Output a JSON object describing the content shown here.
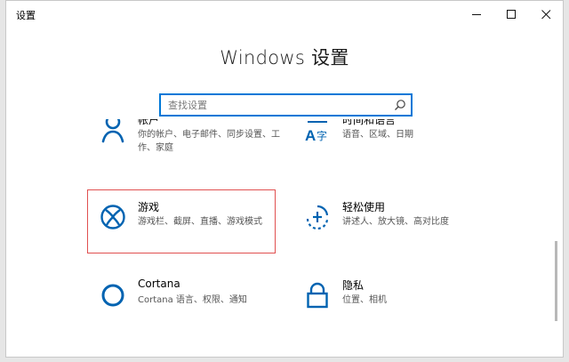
{
  "window": {
    "title": "设置"
  },
  "header": {
    "title": "Windows 设置"
  },
  "search": {
    "placeholder": "查找设置"
  },
  "tiles": [
    {
      "title": "帐户",
      "description": "你的帐户、电子邮件、同步设置、工作、家庭",
      "icon": "person-icon"
    },
    {
      "title": "时间和语言",
      "description": "语音、区域、日期",
      "icon": "time-language-icon"
    },
    {
      "title": "游戏",
      "description": "游戏栏、截屏、直播、游戏模式",
      "icon": "xbox-icon"
    },
    {
      "title": "轻松使用",
      "description": "讲述人、放大镜、高对比度",
      "icon": "ease-of-access-icon"
    },
    {
      "title": "Cortana",
      "description": "Cortana 语言、权限、通知",
      "icon": "cortana-icon"
    },
    {
      "title": "隐私",
      "description": "位置、相机",
      "icon": "lock-icon"
    }
  ],
  "colors": {
    "accent": "#0078d7",
    "highlight": "#e05050"
  }
}
